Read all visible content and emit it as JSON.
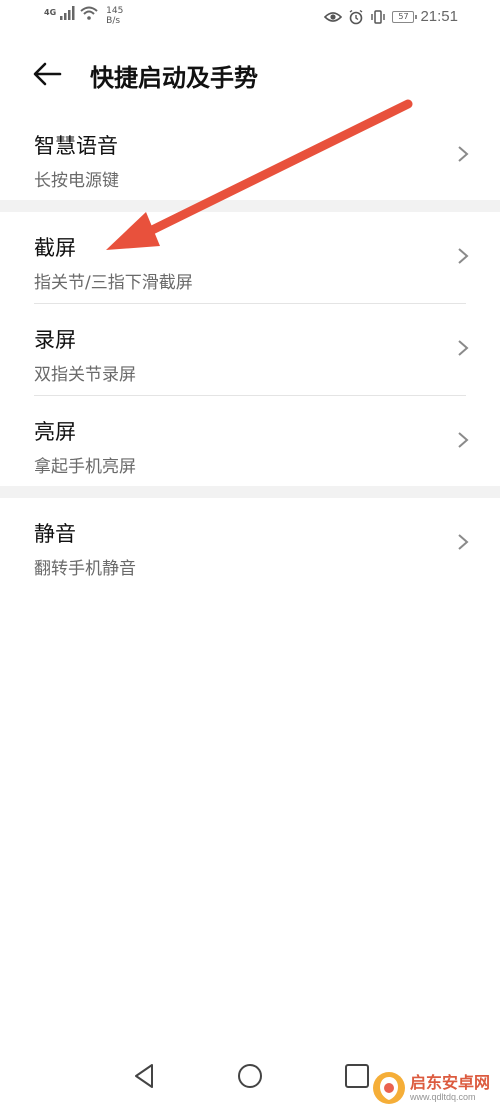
{
  "status_bar": {
    "network": "4G",
    "speed_value": "145",
    "speed_unit": "B/s",
    "battery": "57",
    "time": "21:51",
    "icons": [
      "signal-icon",
      "wifi-icon",
      "eye-icon",
      "alarm-icon",
      "vibrate-icon",
      "battery-icon"
    ]
  },
  "header": {
    "back_icon": "back-arrow-icon",
    "title": "快捷启动及手势"
  },
  "groups": [
    {
      "items": [
        {
          "title": "智慧语音",
          "subtitle": "长按电源键"
        }
      ]
    },
    {
      "items": [
        {
          "title": "截屏",
          "subtitle": "指关节/三指下滑截屏"
        },
        {
          "title": "录屏",
          "subtitle": "双指关节录屏"
        },
        {
          "title": "亮屏",
          "subtitle": "拿起手机亮屏"
        }
      ]
    },
    {
      "items": [
        {
          "title": "静音",
          "subtitle": "翻转手机静音"
        }
      ]
    }
  ],
  "annotation": {
    "type": "red-arrow",
    "color": "#e8513c"
  },
  "nav_bar": {
    "icons": [
      "nav-back-icon",
      "nav-home-icon",
      "nav-recents-icon"
    ]
  },
  "watermark": {
    "name": "启东安卓网",
    "url": "www.qdltdq.com"
  },
  "colors": {
    "separator": "#f2f2f2",
    "subtitle": "#6a6a6a",
    "accent_arrow": "#e8513c"
  }
}
